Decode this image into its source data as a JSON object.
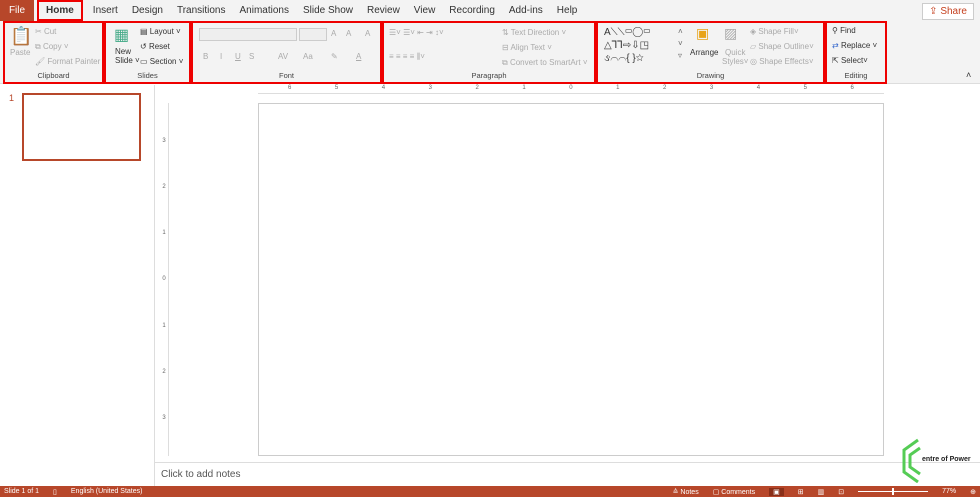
{
  "tabs": [
    "File",
    "Home",
    "Insert",
    "Design",
    "Transitions",
    "Animations",
    "Slide Show",
    "Review",
    "View",
    "Recording",
    "Add-ins",
    "Help"
  ],
  "share": "Share",
  "clipboard": {
    "label": "Clipboard",
    "paste": "Paste",
    "cut": "Cut",
    "copy": "Copy",
    "format_painter": "Format Painter"
  },
  "slides": {
    "label": "Slides",
    "new_slide_1": "New",
    "new_slide_2": "Slide",
    "layout": "Layout",
    "reset": "Reset",
    "section": "Section"
  },
  "font": {
    "label": "Font",
    "bold": "B",
    "italic": "I",
    "underline": "U",
    "strike": "S",
    "grow": "A",
    "shrink": "A",
    "clear": "A",
    "aa": "Aa",
    "spacing": "AV",
    "color": "A"
  },
  "paragraph": {
    "label": "Paragraph",
    "text_direction": "Text Direction",
    "align_text": "Align Text",
    "smartart": "Convert to SmartArt"
  },
  "drawing": {
    "label": "Drawing",
    "arrange": "Arrange",
    "quick_styles_1": "Quick",
    "quick_styles_2": "Styles",
    "shape_fill": "Shape Fill",
    "shape_outline": "Shape Outline",
    "shape_effects": "Shape Effects"
  },
  "editing": {
    "label": "Editing",
    "find": "Find",
    "replace": "Replace",
    "select": "Select"
  },
  "ruler_h": [
    "6",
    "5",
    "4",
    "3",
    "2",
    "1",
    "0",
    "1",
    "2",
    "3",
    "4",
    "5",
    "6"
  ],
  "ruler_v": [
    "3",
    "2",
    "1",
    "0",
    "1",
    "2",
    "3"
  ],
  "thumbnail_number": "1",
  "notes_placeholder": "Click to add notes",
  "status": {
    "slide": "Slide 1 of 1",
    "language": "English (United States)",
    "notes": "Notes",
    "comments": "Comments",
    "zoom": "77%",
    "zoom_fraction": 0.77
  },
  "watermark": "entre of Power",
  "colors": {
    "accent": "#b7472a",
    "highlight": "#e00000"
  }
}
